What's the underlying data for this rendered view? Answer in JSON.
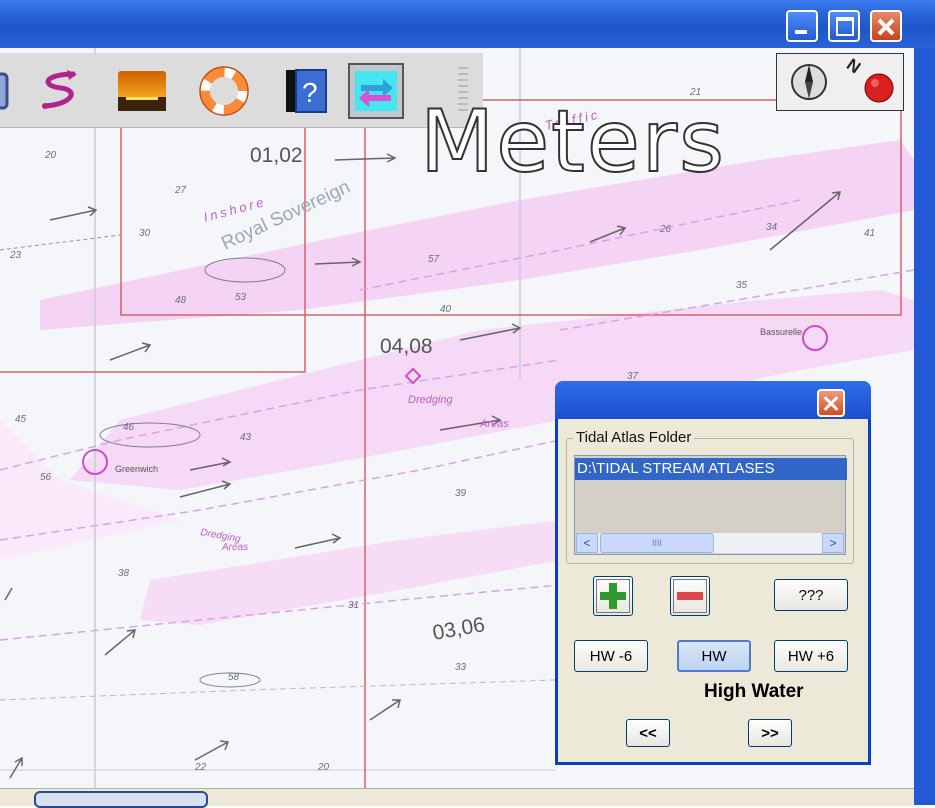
{
  "window": {
    "controls": [
      "minimize-icon",
      "maximize-icon",
      "close-icon"
    ],
    "accent_color": "#2459d6"
  },
  "toolbar": {
    "icons": [
      "route-icon",
      "sunset-icon",
      "lifebuoy-icon",
      "help-icon",
      "tidal-streams-icon"
    ],
    "active": "tidal-streams-icon"
  },
  "compass": {
    "icons": [
      "compass-icon",
      "north-icon",
      "record-icon"
    ]
  },
  "overlay": {
    "units_label": "Meters"
  },
  "chart": {
    "depth_labels": [
      "01,02",
      "04,08",
      "03,06"
    ],
    "place_labels": [
      "Inshore",
      "Royal Sovereign",
      "Dredging",
      "Areas",
      "Greenwich",
      "Bassurelle",
      "Dredging",
      "Areas",
      "Traffic"
    ],
    "soundings": [
      "20",
      "27",
      "30",
      "23",
      "48",
      "53",
      "57",
      "40",
      "35",
      "34",
      "41",
      "45",
      "46",
      "43",
      "56",
      "39",
      "38",
      "37",
      "31",
      "33",
      "21",
      "22",
      "20",
      "26",
      "58"
    ]
  },
  "dialog": {
    "group_label": "Tidal Atlas Folder",
    "folder_value": "D:\\TIDAL STREAM ATLASES",
    "add_icon": "plus-icon",
    "remove_icon": "minus-icon",
    "unknown_label": "???",
    "hw_minus_label": "HW -6",
    "hw_label": "HW",
    "hw_plus_label": "HW +6",
    "selected_time": "HW",
    "status_text": "High Water",
    "prev_label": "<<",
    "next_label": ">>",
    "scroll_left": "<",
    "scroll_right": ">",
    "scroll_grip": "IIII"
  }
}
